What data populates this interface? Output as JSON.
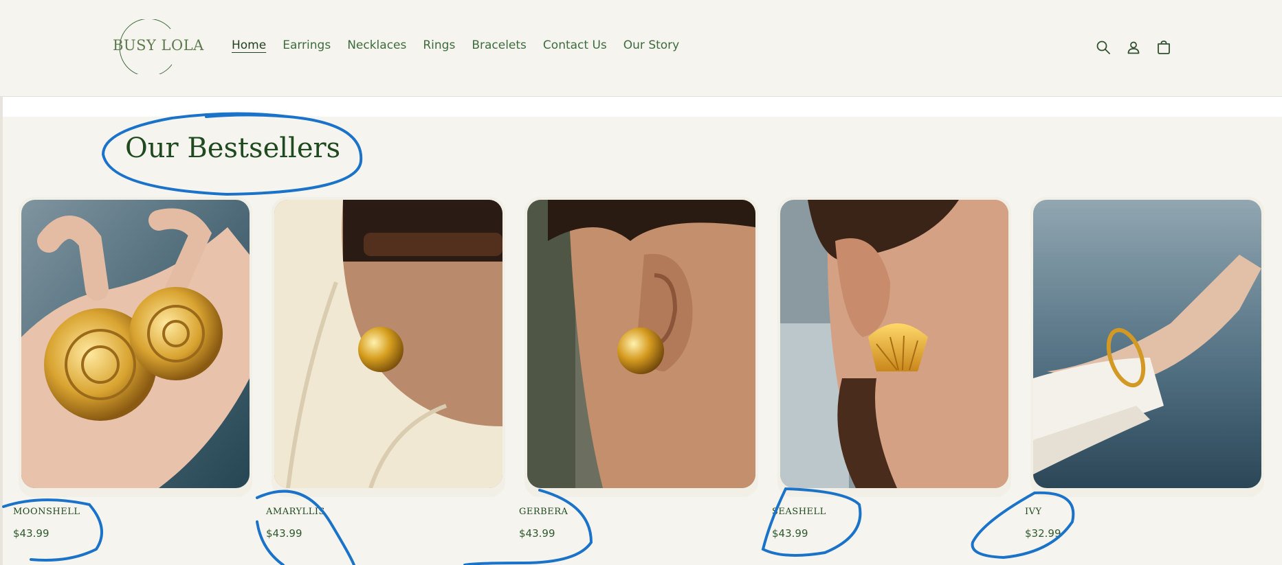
{
  "header": {
    "logo_text": "BUSY LOLA",
    "nav": [
      {
        "label": "Home",
        "active": true
      },
      {
        "label": "Earrings"
      },
      {
        "label": "Necklaces"
      },
      {
        "label": "Rings"
      },
      {
        "label": "Bracelets"
      },
      {
        "label": "Contact Us"
      },
      {
        "label": "Our Story"
      }
    ],
    "icons": [
      "search-icon",
      "account-icon",
      "cart-icon"
    ]
  },
  "section": {
    "title": "Our Bestsellers"
  },
  "products": [
    {
      "name": "MOONSHELL",
      "price": "$43.99"
    },
    {
      "name": "AMARYLLIS",
      "price": "$43.99"
    },
    {
      "name": "GERBERA",
      "price": "$43.99"
    },
    {
      "name": "SEASHELL",
      "price": "$43.99"
    },
    {
      "name": "IVY",
      "price": "$32.99"
    }
  ],
  "colors": {
    "background": "#f5f4ee",
    "brand_green": "#1f4a1f",
    "annotation_blue": "#1a73c9"
  }
}
